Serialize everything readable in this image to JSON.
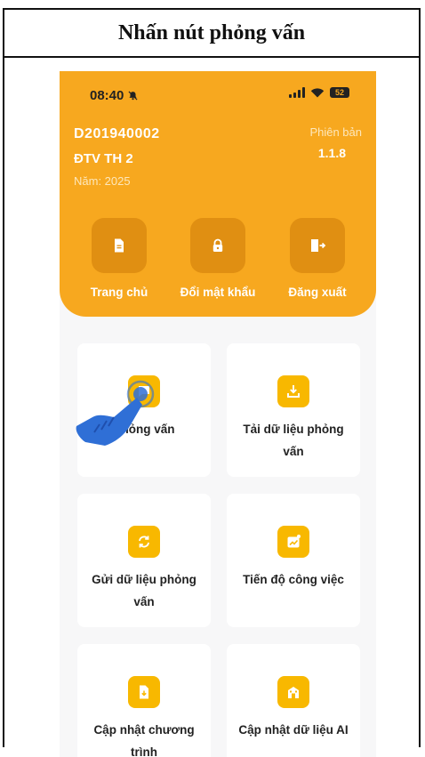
{
  "caption": "Nhấn nút phỏng vấn",
  "status": {
    "time": "08:40",
    "battery": "52"
  },
  "user": {
    "id": "D201940002",
    "role": "ĐTV TH 2",
    "year": "Năm: 2025"
  },
  "version": {
    "label": "Phiên bản",
    "value": "1.1.8"
  },
  "quick_actions": [
    "Trang chủ",
    "Đổi mật khẩu",
    "Đăng xuất"
  ],
  "cards": [
    "Phỏng vấn",
    "Tải dữ liệu phỏng vấn",
    "Gửi dữ liệu phỏng vấn",
    "Tiến độ công việc",
    "Cập nhật chương trình",
    "Cập nhật dữ liệu AI"
  ],
  "colors": {
    "header": "#f7a81f",
    "icon_bg": "#f8b800",
    "hand": "#2f6fd6"
  },
  "icons": [
    "bell-muted-icon",
    "signal-icon",
    "wifi-icon",
    "battery-icon",
    "document-icon",
    "lock-icon",
    "logout-icon",
    "interview-icon",
    "download-icon",
    "sync-icon",
    "progress-chart-icon",
    "update-icon",
    "building-icon",
    "tap-hand-icon"
  ]
}
